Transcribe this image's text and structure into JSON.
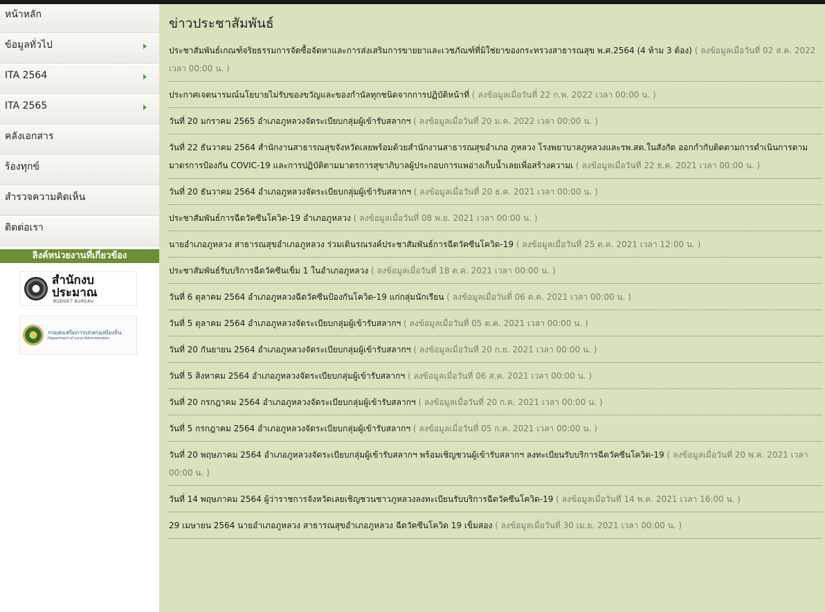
{
  "sidebar": {
    "menu": [
      {
        "label": "หน้าหลัก",
        "has_submenu": false
      },
      {
        "label": "ข้อมูลทั่วไป",
        "has_submenu": true
      },
      {
        "label": "ITA 2564",
        "has_submenu": true
      },
      {
        "label": "ITA 2565",
        "has_submenu": true
      },
      {
        "label": "คลังเอกสาร",
        "has_submenu": false
      },
      {
        "label": "ร้องทุกข์",
        "has_submenu": false
      },
      {
        "label": "สำรวจความคิดเห็น",
        "has_submenu": false
      },
      {
        "label": "ติดต่อเรา",
        "has_submenu": false
      }
    ],
    "links_header": "ลิงค์หน่วยงานที่เกี่ยวข้อง",
    "logos": {
      "budget_main": "สำนักงบประมาณ",
      "budget_sub": "BUDGET BUREAU",
      "dla_main": "กรมส่งเสริมการปกครองท้องถิ่น",
      "dla_sub": "Department of Local Administration"
    }
  },
  "main": {
    "title": "ข่าวประชาสัมพันธ์",
    "news": [
      {
        "title": "ประชาสัมพันธ์เกณฑ์จริยธรรมการจัดซื้อจัดหาและการส่งเสริมการขายยาและเวชภัณฑ์ที่มิใช่ยาของกระทรวงสาธารณสุข พ.ศ.2564 (4 ห้าม 3 ต้อง)",
        "date": " ( ลงข้อมูลเมื่อวันที่ 02 ส.ค. 2022 เวลา 00:00 น. )"
      },
      {
        "title": "ประกาศเจตนารมณ์นโยบายไม่รับของขวัญและของกำนัลทุกชนิดจากการปฏิบัติหน้าที่",
        "date": " ( ลงข้อมูลเมื่อวันที่ 22 ก.พ. 2022 เวลา 00:00 น. )"
      },
      {
        "title": "วันที่ 20 มกราคม 2565 อำเภอภูหลวงจัดระเบียบกลุ่มผู้เข้ารับสลากฯ",
        "date": " ( ลงข้อมูลเมื่อวันที่ 20 ม.ค. 2022 เวลา 00:00 น. )"
      },
      {
        "title": "วันที่ 22 ธันวาคม 2564 สำนักงานสาธารณสุขจังหวัดเลยพร้อมด้วยสำนักงานสาธารณสุขอำเภอ ภูหลวง โรงพยาบาลภูหลวงและรพ.สต.ในสังกัด ออกกำกับติดตามการดำเนินการตามมาตรการป้องกัน COVIC-19 และการปฏิบัติตามมาตรการสุขาภิบาลผู้ประกอบการแพอ่างเก็บน้ำเลยเพื่อสร้างความเ",
        "date": " ( ลงข้อมูลเมื่อวันที่ 22 ธ.ค. 2021 เวลา 00:00 น. )"
      },
      {
        "title": "วันที่ 20 ธันวาคม 2564 อำเภอภูหลวงจัดระเบียบกลุ่มผู้เข้ารับสลากฯ",
        "date": " ( ลงข้อมูลเมื่อวันที่ 20 ธ.ค. 2021 เวลา 00:00 น. )"
      },
      {
        "title": "ประชาสัมพันธ์การฉีดวัคซีนโควิด-19 อำเภอภูหลวง",
        "date": " ( ลงข้อมูลเมื่อวันที่ 08 พ.ย. 2021 เวลา 00:00 น. )"
      },
      {
        "title": "นายอำเภอภูหลวง สาธารณสุขอำเภอภูหลวง ร่วมเดินรณรงค์ประชาสัมพันธ์การฉีดวัคซีนโควิด-19",
        "date": " ( ลงข้อมูลเมื่อวันที่ 25 ต.ค. 2021 เวลา 12:00 น. )"
      },
      {
        "title": "ประชาสัมพันธ์รับบริการฉีดวัคซีนเข็ม 1 ในอำเภอภูหลวง",
        "date": " ( ลงข้อมูลเมื่อวันที่ 18 ต.ค. 2021 เวลา 00:00 น. )"
      },
      {
        "title": "วันที่ 6 ตุลาคม 2564 อำเภอภูหลวงฉีดวัคซีนป้องกันโควิด-19 แก่กลุ่มนักเรียน",
        "date": " ( ลงข้อมูลเมื่อวันที่ 06 ต.ค. 2021 เวลา 00:00 น. )"
      },
      {
        "title": "วันที่ 5 ตุลาคม 2564 อำเภอภูหลวงจัดระเบียบกลุ่มผู้เข้ารับสลากฯ",
        "date": " ( ลงข้อมูลเมื่อวันที่ 05 ต.ค. 2021 เวลา 00:00 น. )"
      },
      {
        "title": "วันที่ 20 กันยายน 2564 อำเภอภูหลวงจัดระเบียบกลุ่มผู้เข้ารับสลากฯ",
        "date": " ( ลงข้อมูลเมื่อวันที่ 20 ก.ย. 2021 เวลา 00:00 น. )"
      },
      {
        "title": "วันที่ 5 สิงหาคม 2564 อำเภอภูหลวงจัดระเบียบกลุ่มผู้เข้ารับสลากฯ",
        "date": " ( ลงข้อมูลเมื่อวันที่ 06 ส.ค. 2021 เวลา 00:00 น. )"
      },
      {
        "title": "วันที่ 20 กรกฎาคม 2564 อำเภอภูหลวงจัดระเบียบกลุ่มผู้เข้ารับสลากฯ",
        "date": " ( ลงข้อมูลเมื่อวันที่ 20 ก.ค. 2021 เวลา 00:00 น. )"
      },
      {
        "title": "วันที่ 5 กรกฎาคม 2564 อำเภอภูหลวงจัดระเบียบกลุ่มผู้เข้ารับสลากฯ",
        "date": " ( ลงข้อมูลเมื่อวันที่ 05 ก.ค. 2021 เวลา 00:00 น. )"
      },
      {
        "title": "วันที่ 20 พฤษภาคม 2564 อำเภอภูหลวงจัดระเบียบกลุ่มผู้เข้ารับสลากฯ พร้อมเชิญชวนผู้เข้ารับสลากฯ ลงทะเบียนรับบริการฉีดวัคซีนโควิด-19",
        "date": " ( ลงข้อมูลเมื่อวันที่ 20 พ.ค. 2021 เวลา 00:00 น. )"
      },
      {
        "title": "วันที่ 14 พฤษภาคม 2564 ผู้ว่าราชการจังหวัดเลยเชิญชวนชาวภูหลวงลงทะเบียนรับบริการฉีดวัคซีนโควิด-19",
        "date": " ( ลงข้อมูลเมื่อวันที่ 14 พ.ค. 2021 เวลา 16:00 น. )"
      },
      {
        "title": "29 เมษายน 2564 นายอำเภอภูหลวง สาธารณสุขอำเภอภูหลวง ฉีดวัคซีนโควิด 19 เข็มสอง",
        "date": " ( ลงข้อมูลเมื่อวันที่ 30 เม.ย. 2021 เวลา 00:00 น. )"
      }
    ]
  }
}
